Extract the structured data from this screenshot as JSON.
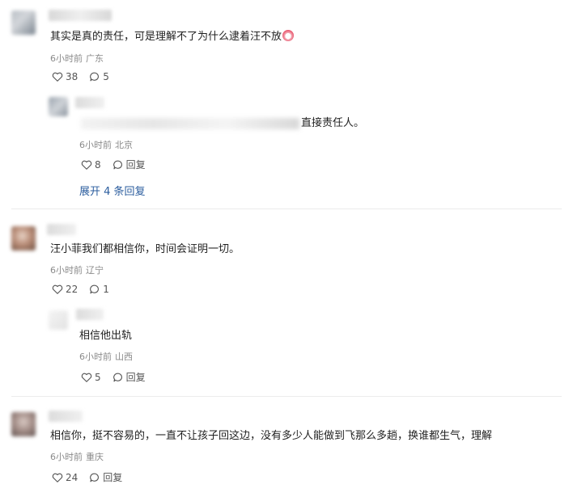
{
  "comments": [
    {
      "text": "其实是真的责任，可是理解不了为什么逮着汪不放",
      "time": "6小时前",
      "location": "广东",
      "likes": "38",
      "replies": "5",
      "icons": [
        "heart-icon",
        "comment-icon",
        "crying-emoji-icon"
      ]
    },
    {
      "text": "汪小菲我们都相信你，时间会证明一切。",
      "time": "6小时前",
      "location": "辽宁",
      "likes": "22",
      "replies": "1"
    },
    {
      "text": "相信你，挺不容易的，一直不让孩子回这边，没有多少人能做到飞那么多趟，换谁都生气，理解",
      "time": "6小时前",
      "location": "重庆",
      "likes": "24",
      "reply_label": "回复"
    }
  ],
  "replies": [
    {
      "text_visible": "直接责任人。",
      "time": "6小时前",
      "location": "北京",
      "likes": "8",
      "reply_label": "回复"
    },
    {
      "text": "相信他出轨",
      "time": "6小时前",
      "location": "山西",
      "likes": "5",
      "reply_label": "回复"
    }
  ],
  "expand_label": "展开 4 条回复"
}
